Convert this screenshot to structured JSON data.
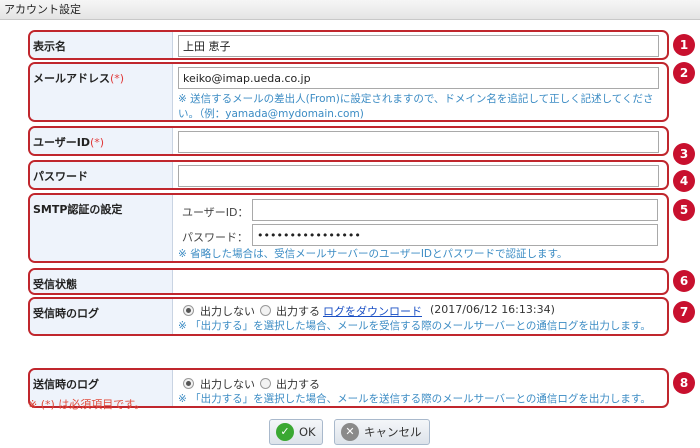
{
  "window": {
    "title": "アカウント設定"
  },
  "fields": {
    "display_name": {
      "label": "表示名",
      "value": "上田 恵子"
    },
    "email": {
      "label": "メールアドレス",
      "required_mark": "(*)",
      "value": "keiko@imap.ueda.co.jp",
      "note_line1": "※ 送信するメールの差出人(From)に設定されますので、ドメイン名を追記して正しく記述してくださ",
      "note_line2": "い。（例：yamada@mydomain.com)"
    },
    "user_id": {
      "label": "ユーザーID",
      "required_mark": "(*)",
      "value": ""
    },
    "password": {
      "label": "パスワード",
      "value": ""
    },
    "smtp": {
      "label": "SMTP認証の設定",
      "user_label": "ユーザーID：",
      "user_value": "",
      "password_label": "パスワード：",
      "password_value": "••••••••••••••••",
      "note": "※ 省略した場合は、受信メールサーバーのユーザーIDとパスワードで認証します。"
    },
    "receive_status": {
      "label": "受信状態"
    },
    "receive_log": {
      "label": "受信時のログ",
      "option_off": "出力しない",
      "option_on": "出力する",
      "selected": "出力しない",
      "download_link": "ログをダウンロード",
      "timestamp": "(2017/06/12 16:13:34)",
      "note": "※ 「出力する」を選択した場合、メールを受信する際のメールサーバーとの通信ログを出力します。"
    },
    "send_log": {
      "label": "送信時のログ",
      "option_off": "出力しない",
      "option_on": "出力する",
      "selected": "出力しない",
      "note": "※ 「出力する」を選択した場合、メールを送信する際のメールサーバーとの通信ログを出力します。"
    }
  },
  "badges": [
    "1",
    "2",
    "3",
    "4",
    "5",
    "6",
    "7",
    "8"
  ],
  "footnote": "※ (*) は必須項目です。",
  "buttons": {
    "ok": "OK",
    "cancel": "キャンセル"
  },
  "colors": {
    "highlight_border": "#c0262d",
    "badge": "#c8102e",
    "note_text": "#3c8cc4",
    "required": "#e03a3a",
    "ok_icon": "#3aa832",
    "cancel_icon": "#8a8a8a"
  },
  "icons": {
    "ok": "check-circle-icon",
    "cancel": "x-circle-icon"
  }
}
